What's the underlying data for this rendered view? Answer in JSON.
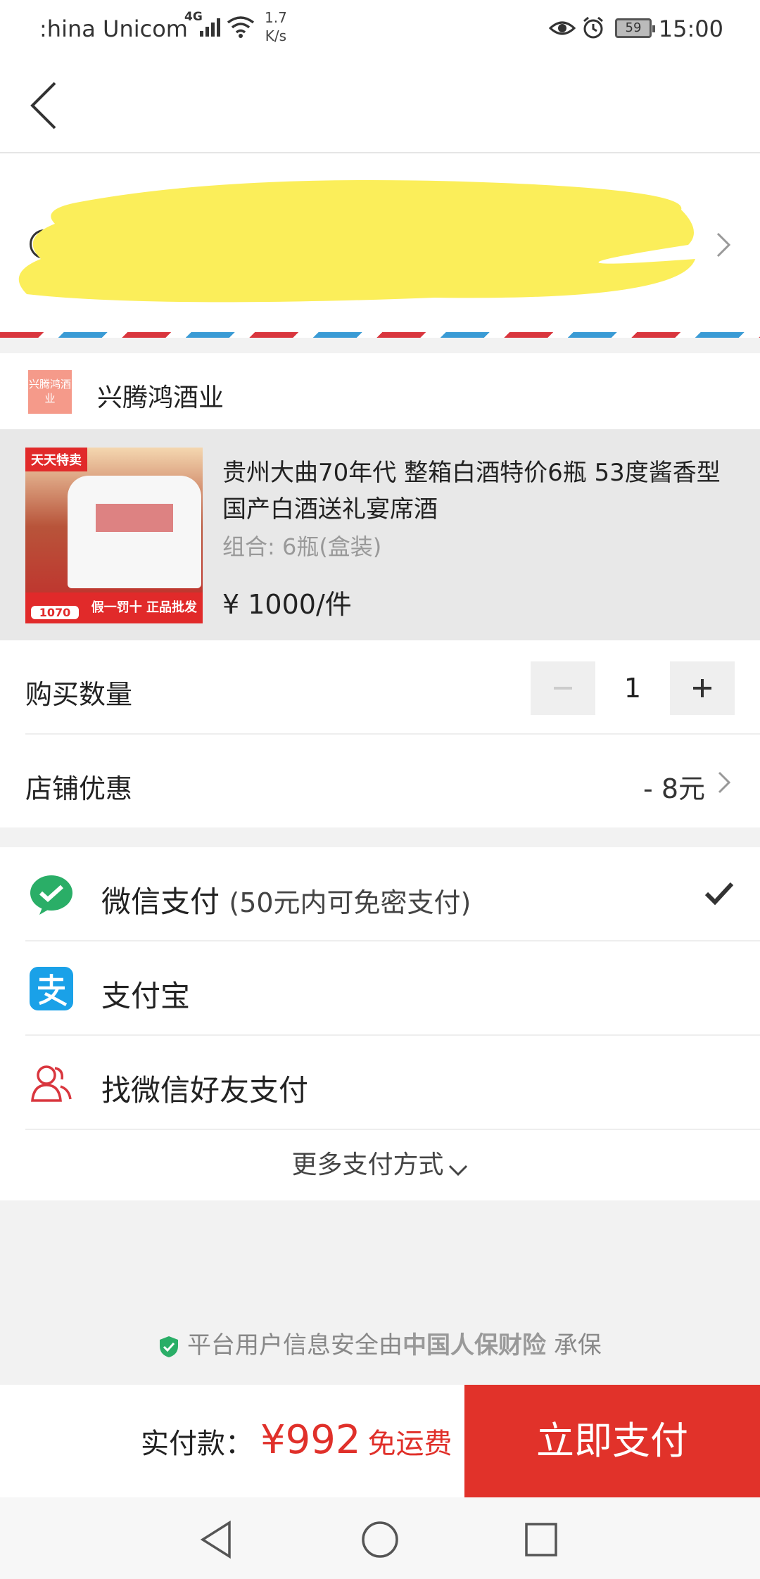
{
  "status_bar": {
    "carrier": ":hina Unicom",
    "network": "4G",
    "speed_value": "1.7",
    "speed_unit": "K/s",
    "battery": "59",
    "time": "15:00"
  },
  "shop": {
    "logo_text": "兴腾鸿酒业",
    "name": "兴腾鸿酒业"
  },
  "product": {
    "image_tag": "天天特卖",
    "image_strip": "假一罚十 正品批发",
    "image_price": "1070",
    "title": "贵州大曲70年代 整箱白酒特价6瓶 53度酱香型国产白酒送礼宴席酒",
    "spec": "组合: 6瓶(盒装)",
    "price": "¥ 1000/件"
  },
  "quantity": {
    "label": "购买数量",
    "value": "1"
  },
  "discount": {
    "label": "店铺优惠",
    "value": "- 8元"
  },
  "payments": [
    {
      "label": "微信支付",
      "note": "(50元内可免密支付)",
      "icon": "wechat-pay-icon",
      "selected": true
    },
    {
      "label": "支付宝",
      "note": "",
      "icon": "alipay-icon",
      "selected": false
    },
    {
      "label": "找微信好友支付",
      "note": "",
      "icon": "friend-pay-icon",
      "selected": false
    }
  ],
  "more_payments": "更多支付方式",
  "insurance": {
    "prefix": "平台用户信息安全由",
    "brand": "中国人保财险",
    "suffix": "承保"
  },
  "footer": {
    "total_label": "实付款：",
    "total": "¥992",
    "shipping": "免运费",
    "pay_button": "立即支付"
  },
  "colors": {
    "accent": "#e1322a",
    "wechat": "#2aae67",
    "alipay": "#1aa1e8"
  }
}
